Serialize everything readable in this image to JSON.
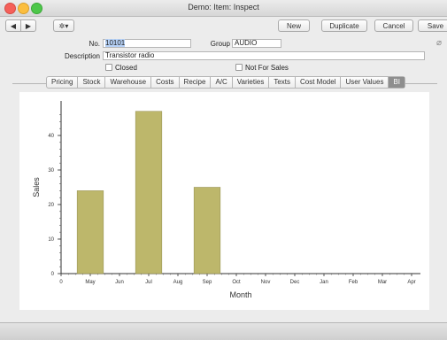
{
  "window": {
    "title": "Demo: Item: Inspect"
  },
  "toolbar": {
    "back_icon": "◀",
    "forward_icon": "▶",
    "gear_icon": "✲▾",
    "new_label": "New",
    "duplicate_label": "Duplicate",
    "cancel_label": "Cancel",
    "save_label": "Save"
  },
  "form": {
    "no_label": "No.",
    "no_value": "10101",
    "group_label": "Group",
    "group_value": "AUDIO",
    "description_label": "Description",
    "description_value": "Transistor radio",
    "closed_label": "Closed",
    "not_for_sales_label": "Not For Sales"
  },
  "tabs": [
    "Pricing",
    "Stock",
    "Warehouse",
    "Costs",
    "Recipe",
    "A/C",
    "Varieties",
    "Texts",
    "Cost Model",
    "User Values",
    "BI"
  ],
  "active_tab": "BI",
  "chart_data": {
    "type": "bar",
    "categories": [
      "0",
      "May",
      "Jun",
      "Jul",
      "Aug",
      "Sep",
      "Oct",
      "Nov",
      "Dec",
      "Jan",
      "Feb",
      "Mar",
      "Apr"
    ],
    "values": [
      0,
      24,
      0,
      47,
      0,
      25,
      0,
      0,
      0,
      0,
      0,
      0,
      0
    ],
    "xlabel": "Month",
    "ylabel": "Sales",
    "ylim": [
      0,
      50
    ],
    "yticks": [
      0,
      10,
      20,
      30,
      40
    ],
    "bar_color": "#bdb76b",
    "grid": false
  }
}
